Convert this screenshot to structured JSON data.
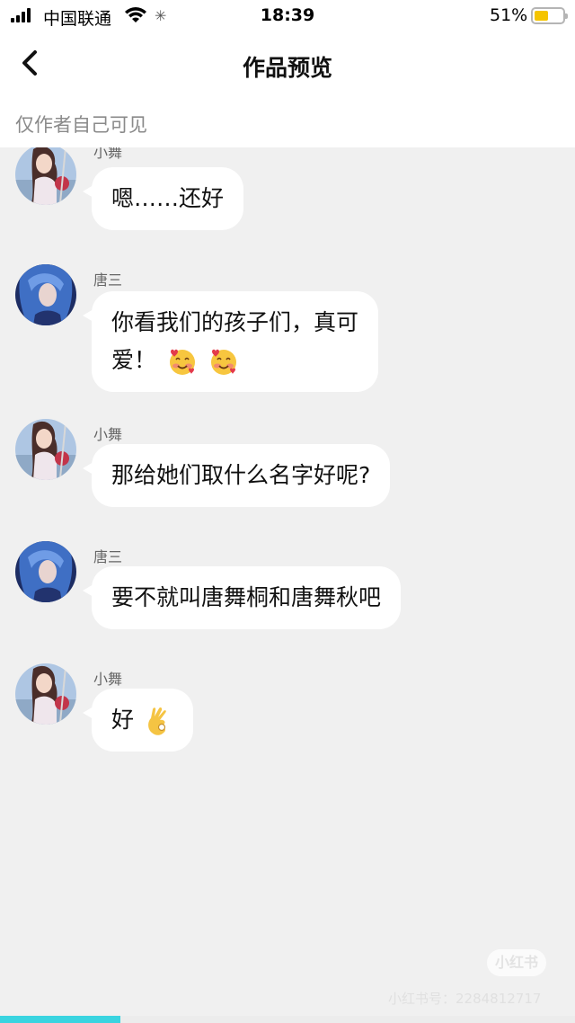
{
  "status_bar": {
    "carrier": "中国联通",
    "time": "18:39",
    "battery_percent": "51%",
    "battery_level": 0.51,
    "signal_icon": "signal-bars-icon",
    "wifi_icon": "wifi-icon",
    "activity_icon": "loading-spinner-icon"
  },
  "nav": {
    "title": "作品预览",
    "back_icon": "chevron-left-icon"
  },
  "visibility_note": "仅作者自己可见",
  "messages": [
    {
      "sender": "小舞",
      "text": "嗯……还好",
      "emoji": []
    },
    {
      "sender": "唐三",
      "text_line1": "你看我们的孩子们，真可",
      "text_line2": "爱！",
      "emoji": [
        "smiling-face-with-hearts",
        "smiling-face-with-hearts"
      ]
    },
    {
      "sender": "小舞",
      "text": "那给她们取什么名字好呢?",
      "emoji": []
    },
    {
      "sender": "唐三",
      "text": "要不就叫唐舞桐和唐舞秋吧",
      "emoji": []
    },
    {
      "sender": "小舞",
      "text": "好",
      "emoji": [
        "ok-hand"
      ]
    }
  ],
  "watermark": {
    "badge": "小红书",
    "id_text": "小红书号：2284812717"
  },
  "video_progress": 0.21,
  "colors": {
    "background": "#f0f0f0",
    "bubble": "#ffffff",
    "battery": "#f5c400",
    "progress": "#3ad4e0"
  }
}
